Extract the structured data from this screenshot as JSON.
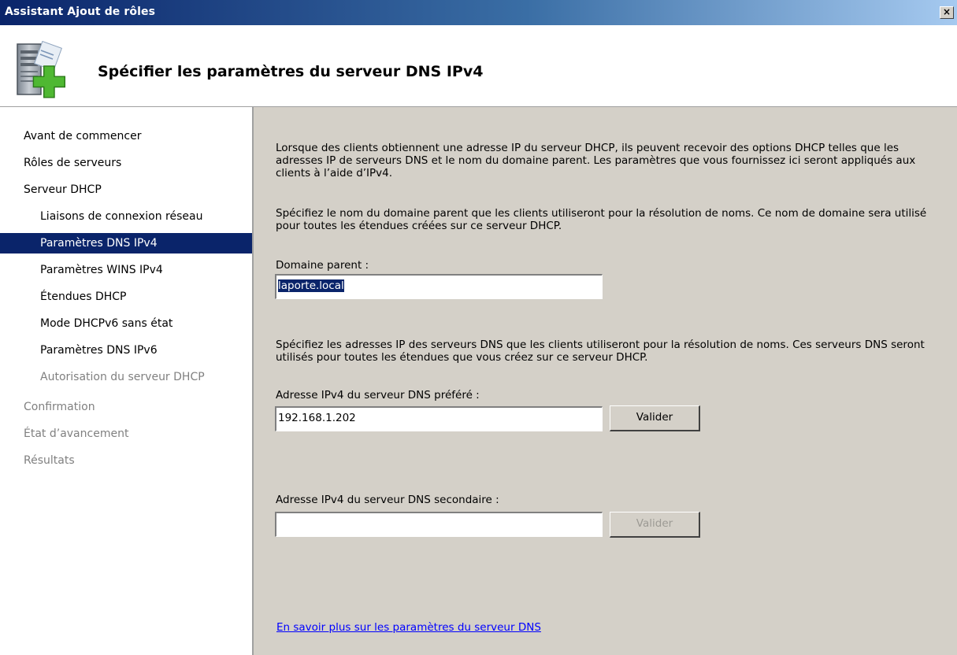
{
  "window": {
    "title": "Assistant Ajout de rôles",
    "close_label": "×"
  },
  "header": {
    "icon": "server-add-role-icon",
    "title": "Spécifier les paramètres du serveur DNS IPv4"
  },
  "sidebar": {
    "items": [
      {
        "label": "Avant de commencer",
        "level": 0,
        "state": "normal"
      },
      {
        "label": "Rôles de serveurs",
        "level": 0,
        "state": "normal"
      },
      {
        "label": "Serveur DHCP",
        "level": 0,
        "state": "normal"
      },
      {
        "label": "Liaisons de connexion réseau",
        "level": 1,
        "state": "normal"
      },
      {
        "label": "Paramètres DNS IPv4",
        "level": 1,
        "state": "active"
      },
      {
        "label": "Paramètres WINS IPv4",
        "level": 1,
        "state": "normal"
      },
      {
        "label": "Étendues DHCP",
        "level": 1,
        "state": "normal"
      },
      {
        "label": "Mode DHCPv6 sans état",
        "level": 1,
        "state": "normal"
      },
      {
        "label": "Paramètres DNS IPv6",
        "level": 1,
        "state": "normal"
      },
      {
        "label": "Autorisation du serveur DHCP",
        "level": 1,
        "state": "disabled"
      },
      {
        "label": "Confirmation",
        "level": 0,
        "state": "disabled"
      },
      {
        "label": "État d’avancement",
        "level": 0,
        "state": "disabled"
      },
      {
        "label": "Résultats",
        "level": 0,
        "state": "disabled"
      }
    ]
  },
  "content": {
    "intro": "Lorsque des clients obtiennent une adresse IP du serveur DHCP, ils peuvent recevoir des options DHCP telles que les adresses IP de serveurs DNS et le nom du domaine parent. Les paramètres que vous fournissez ici seront appliqués aux clients à l’aide d’IPv4.",
    "domain_instructions": "Spécifiez le nom du domaine parent que les clients utiliseront pour la résolution de noms. Ce nom de domaine sera utilisé pour toutes les étendues créées sur ce serveur DHCP.",
    "domain_label": "Domaine parent :",
    "domain_value": "laporte.local",
    "dns_instructions": "Spécifiez les adresses IP des serveurs DNS que les clients utiliseront pour la résolution de noms. Ces serveurs DNS seront utilisés pour toutes les étendues que vous créez sur ce serveur DHCP.",
    "preferred_label": "Adresse IPv4 du serveur DNS préféré :",
    "preferred_value": "192.168.1.202",
    "validate_label": "Valider",
    "secondary_label": "Adresse IPv4 du serveur DNS secondaire :",
    "secondary_value": "",
    "validate_secondary_label": "Valider",
    "help_link": "En savoir plus sur les paramètres du serveur DNS"
  },
  "colors": {
    "selection": "#0a246a",
    "panel": "#d4d0c8",
    "link": "#0000ff",
    "disabled_text": "#808080"
  }
}
